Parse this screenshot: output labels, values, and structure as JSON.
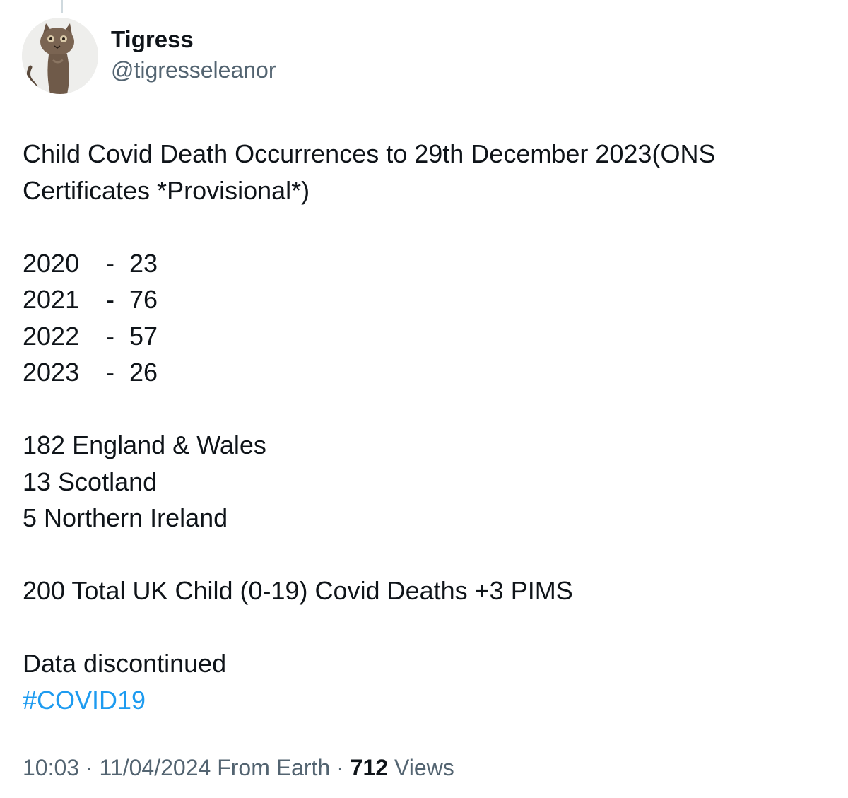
{
  "author": {
    "display_name": "Tigress",
    "handle": "@tigresseleanor",
    "avatar_icon": "cat-figurine-avatar"
  },
  "tweet": {
    "heading": "Child Covid Death Occurrences to 29th December 2023(ONS Certificates *Provisional*)",
    "years": [
      {
        "year": "2020",
        "sep": "-",
        "count": "23"
      },
      {
        "year": "2021",
        "sep": "-",
        "count": "76"
      },
      {
        "year": "2022",
        "sep": "-",
        "count": "57"
      },
      {
        "year": "2023",
        "sep": "-",
        "count": "26"
      }
    ],
    "regions": [
      "182 England & Wales",
      "13 Scotland",
      "5 Northern Ireland"
    ],
    "total": "200 Total UK Child (0-19) Covid Deaths +3 PIMS",
    "note": "Data discontinued",
    "hashtag": "#COVID19"
  },
  "meta": {
    "time": "10:03",
    "date": "11/04/2024",
    "source": "From Earth",
    "views_count": "712",
    "views_label": "Views",
    "separator": "·"
  },
  "colors": {
    "text": "#0f1419",
    "secondary": "#536471",
    "link": "#1d9bf0"
  }
}
